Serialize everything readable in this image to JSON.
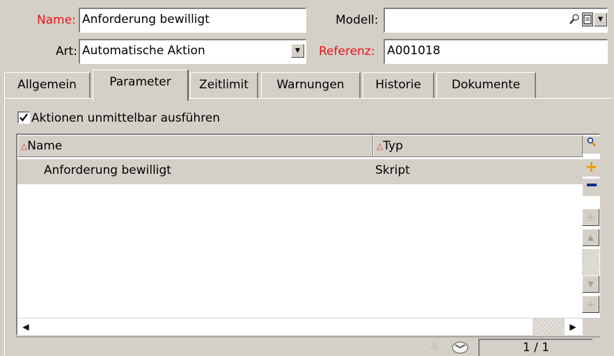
{
  "header": {
    "name_label": "Name:",
    "name_value": "Anforderung bewilligt",
    "art_label": "Art:",
    "art_value": "Automatische Aktion",
    "modell_label": "Modell:",
    "modell_value": "",
    "referenz_label": "Referenz:",
    "referenz_value": "A001018"
  },
  "tabs": [
    {
      "label": "Allgemein"
    },
    {
      "label": "Parameter"
    },
    {
      "label": "Zeitlimit"
    },
    {
      "label": "Warnungen"
    },
    {
      "label": "Historie"
    },
    {
      "label": "Dokumente"
    }
  ],
  "active_tab": "Parameter",
  "panel": {
    "checkbox_label": "Aktionen unmittelbar ausführen",
    "checkbox_checked": true
  },
  "table": {
    "columns": [
      "Name",
      "Typ"
    ],
    "rows": [
      {
        "name": "Anforderung bewilligt",
        "typ": "Skript"
      }
    ]
  },
  "status": {
    "page_count": "1 / 1"
  },
  "colors": {
    "required_label": "#e8101a",
    "selected_row": "#d4d0c8",
    "add_button": "#e89a00",
    "remove_button": "#0b2b8a"
  },
  "icons": {
    "modell_lookup": "magnifier-icon",
    "modell_details": "form-icon",
    "table_search": "magnifier-icon",
    "table_add": "plus-icon",
    "table_remove": "minus-icon"
  }
}
